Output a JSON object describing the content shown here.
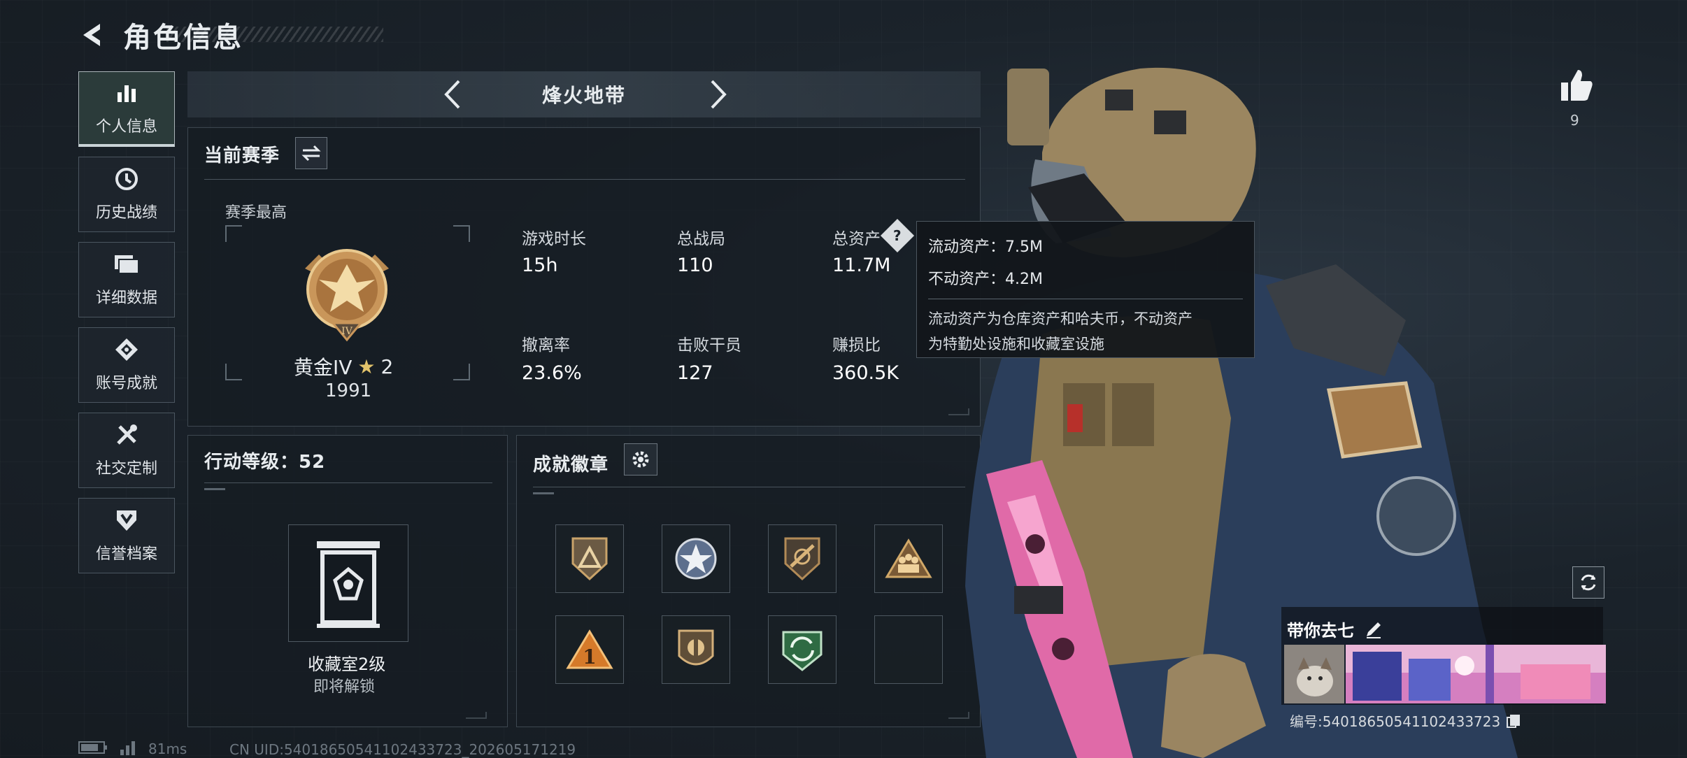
{
  "header": {
    "title": "角色信息"
  },
  "sidebar": {
    "items": [
      {
        "label": "个人信息",
        "icon": "bar-chart-icon",
        "active": true
      },
      {
        "label": "历史战绩",
        "icon": "history-icon"
      },
      {
        "label": "详细数据",
        "icon": "folder-icon"
      },
      {
        "label": "账号成就",
        "icon": "achievement-icon"
      },
      {
        "label": "社交定制",
        "icon": "tools-icon"
      },
      {
        "label": "信誉档案",
        "icon": "shield-icon"
      }
    ]
  },
  "mode": {
    "title": "烽火地带"
  },
  "season": {
    "title": "当前赛季",
    "best_label": "赛季最高",
    "rank_name": "黄金IV",
    "rank_stars": "2",
    "rank_score": "1991",
    "stats": [
      {
        "label": "游戏时长",
        "value": "15h"
      },
      {
        "label": "总战局",
        "value": "110"
      },
      {
        "label": "总资产",
        "value": "11.7M"
      },
      {
        "label": "撤离率",
        "value": "23.6%"
      },
      {
        "label": "击败干员",
        "value": "127"
      },
      {
        "label": "赚损比",
        "value": "360.5K"
      }
    ]
  },
  "tooltip": {
    "liquid": "流动资产：7.5M",
    "fixed": "不动资产：4.2M",
    "desc_line1": "流动资产为仓库资产和哈夫币，不动资产",
    "desc_line2": "为特勤处设施和收藏室设施"
  },
  "action_level": {
    "title": "行动等级：52",
    "vault_title": "收藏室2级",
    "vault_sub": "即将解锁"
  },
  "achievements": {
    "title": "成就徽章",
    "badges": [
      "triangle-badge-icon",
      "star-badge-icon",
      "rifle-badge-icon",
      "soldiers-badge-icon",
      "number-one-badge-icon",
      "emblem-badge-icon",
      "green-arrows-badge-icon",
      "empty-slot"
    ]
  },
  "likes": {
    "count": "9"
  },
  "card": {
    "name": "带你去七",
    "id": "编号:5401865054110243372​3"
  },
  "footer": {
    "ping": "81ms",
    "uid": "CN UID:5401865054110243372​3_202605171219"
  },
  "colors": {
    "background": "#1a2129",
    "accent_gold": "#e2c36b",
    "panel_border": "#3d4750"
  }
}
